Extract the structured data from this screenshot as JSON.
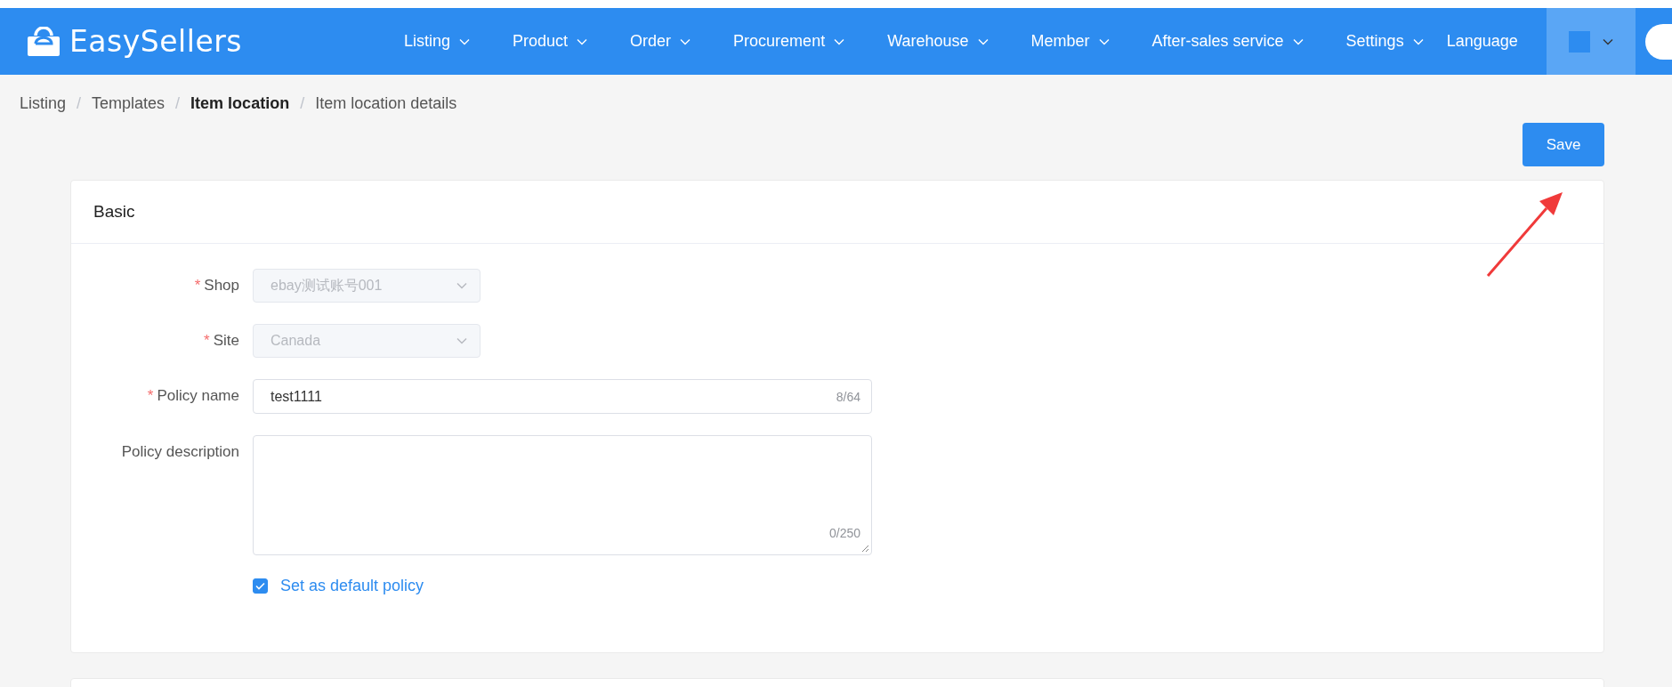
{
  "header": {
    "logo_text": "EasySellers",
    "nav": [
      {
        "label": "Listing"
      },
      {
        "label": "Product"
      },
      {
        "label": "Order"
      },
      {
        "label": "Procurement"
      },
      {
        "label": "Warehouse"
      },
      {
        "label": "Member"
      },
      {
        "label": "After-sales service"
      },
      {
        "label": "Settings"
      }
    ],
    "language_label": "Language"
  },
  "breadcrumb": [
    {
      "label": "Listing",
      "current": false
    },
    {
      "separator": "/",
      "label": "Templates",
      "current": false
    },
    {
      "separator": "/",
      "label": "Item location",
      "current": true
    },
    {
      "separator": "/",
      "label": "Item location details",
      "current": false
    }
  ],
  "save_button": "Save",
  "card": {
    "title": "Basic",
    "fields": [
      {
        "kind": "select",
        "required_mark": "*",
        "label": "Shop",
        "value": "ebay测试账号001",
        "disabled": true
      },
      {
        "kind": "select",
        "required_mark": "*",
        "label": "Site",
        "value": "Canada",
        "disabled": true
      },
      {
        "kind": "input",
        "required_mark": "*",
        "label": "Policy name",
        "value": "test1111",
        "counter": "8/64"
      },
      {
        "kind": "textarea",
        "label": "Policy description",
        "counter": "0/250"
      }
    ],
    "checkbox": {
      "label": "Set as default policy",
      "checked": true
    }
  }
}
